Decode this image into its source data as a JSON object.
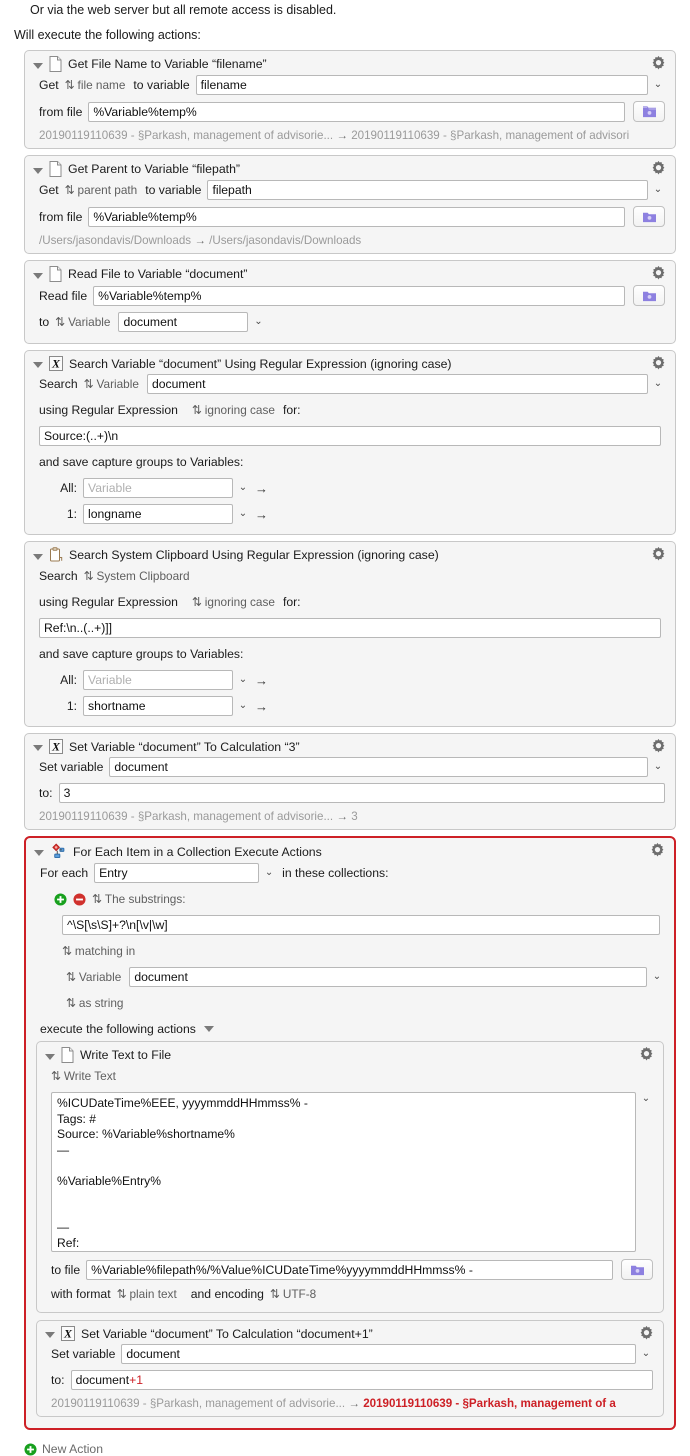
{
  "intro": {
    "line1": "Or via the web server but all remote access is disabled.",
    "line2": "Will execute the following actions:"
  },
  "colors": {
    "group_border": "#cd2026",
    "result_red": "#cd2026",
    "folder_icon": "#7c6fd6",
    "add_green": "#18a01e",
    "remove_red": "#d0312d"
  },
  "actions": [
    {
      "title": "Get File Name to Variable “filename”",
      "icon": "document-icon",
      "row1": {
        "label": "Get",
        "popup": "file name",
        "label2": "to variable",
        "value": "filename"
      },
      "row2": {
        "label": "from file",
        "value": "%Variable%temp%"
      },
      "result_left": "20190119110639 - §Parkash, management of advisorie...",
      "result_right": "20190119110639 - §Parkash, management of advisori"
    },
    {
      "title": "Get Parent to Variable “filepath”",
      "icon": "document-icon",
      "row1": {
        "label": "Get",
        "popup": "parent path",
        "label2": "to variable",
        "value": "filepath"
      },
      "row2": {
        "label": "from file",
        "value": "%Variable%temp%"
      },
      "result_left": "/Users/jasondavis/Downloads",
      "result_right": "/Users/jasondavis/Downloads"
    },
    {
      "title": "Read File to Variable “document”",
      "icon": "document-icon",
      "row1": {
        "label": "Read file",
        "value": "%Variable%temp%"
      },
      "row2": {
        "label": "to",
        "popup": "Variable",
        "value": "document"
      }
    },
    {
      "title": "Search Variable “document” Using Regular Expression (ignoring case)",
      "icon": "calculation-x-icon",
      "search_label": "Search",
      "search_popup": "Variable",
      "search_value": "document",
      "regex_label": "using Regular Expression",
      "regex_popup": "ignoring case",
      "regex_for": "for:",
      "regex_value": "Source:(..+)\\n",
      "capture_label": "and save capture groups to Variables:",
      "captures": [
        {
          "index": "All:",
          "value": "",
          "placeholder": "Variable"
        },
        {
          "index": "1:",
          "value": "longname",
          "placeholder": "Variable"
        }
      ]
    },
    {
      "title": "Search System Clipboard Using Regular Expression (ignoring case)",
      "icon": "clipboard-icon",
      "search_label": "Search",
      "search_popup": "System Clipboard",
      "regex_label": "using Regular Expression",
      "regex_popup": "ignoring case",
      "regex_for": "for:",
      "regex_value": "Ref:\\n..(..+)]]",
      "capture_label": "and save capture groups to Variables:",
      "captures": [
        {
          "index": "All:",
          "value": "",
          "placeholder": "Variable"
        },
        {
          "index": "1:",
          "value": "shortname",
          "placeholder": "Variable"
        }
      ]
    },
    {
      "title": "Set Variable “document” To Calculation “3”",
      "icon": "calculation-x-icon",
      "row1": {
        "label": "Set variable",
        "value": "document"
      },
      "row2": {
        "label": "to:",
        "value": "3"
      },
      "result_left": "20190119110639 - §Parkash, management of advisorie...",
      "result_right": "3"
    }
  ],
  "group": {
    "title": "For Each Item in a Collection Execute Actions",
    "icon": "for-each-icon",
    "for_each_label": "For each",
    "for_each_value": "Entry",
    "in_collections_label": "in these collections:",
    "substrings_popup": "The substrings:",
    "substrings_value": "^\\S[\\s\\S]+?\\n[\\v|\\w]",
    "matching_in_popup": "matching in",
    "variable_popup": "Variable",
    "variable_value": "document",
    "as_string_popup": "as string",
    "execute_label": "execute the following actions",
    "inner_actions": [
      {
        "title": "Write Text to File",
        "icon": "document-icon",
        "write_text_popup": "Write Text",
        "text_value": "%ICUDateTime%EEE, yyyymmddHHmmss% -\nTags: #\nSource: %Variable%shortname%\n—\n\n%Variable%Entry%\n\n\n—\nRef:\n%Variable%shortname%",
        "to_file_label": "to file",
        "to_file_value": "%Variable%filepath%/%Value%ICUDateTime%yyyymmddHHmmss% -",
        "format_label": "with format",
        "format_popup": "plain text",
        "encoding_label": "and encoding",
        "encoding_popup": "UTF-8"
      },
      {
        "title": "Set Variable “document” To Calculation “document+1”",
        "icon": "calculation-x-icon",
        "row1": {
          "label": "Set variable",
          "value": "document"
        },
        "row2": {
          "label": "to:",
          "value": "document",
          "value_red": "+1"
        },
        "result_left": "20190119110639 - §Parkash, management of advisorie...",
        "result_right": "20190119110639 - §Parkash, management of a"
      }
    ]
  },
  "footer": {
    "new_action_label": "New Action",
    "icon": "add-circle-icon"
  }
}
